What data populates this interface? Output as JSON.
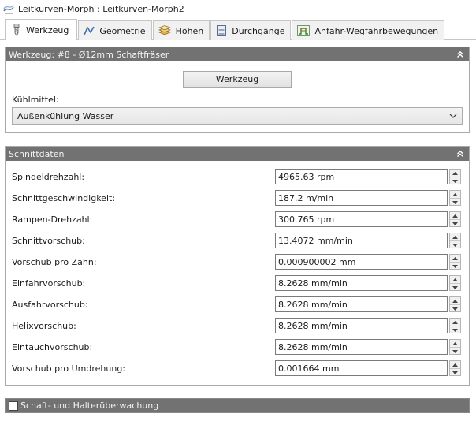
{
  "window": {
    "title": "Leitkurven-Morph : Leitkurven-Morph2"
  },
  "tabs": [
    {
      "label": "Werkzeug",
      "icon": "tool-icon",
      "active": true
    },
    {
      "label": "Geometrie",
      "icon": "geometry-icon",
      "active": false
    },
    {
      "label": "Höhen",
      "icon": "heights-icon",
      "active": false
    },
    {
      "label": "Durchgänge",
      "icon": "passes-icon",
      "active": false
    },
    {
      "label": "Anfahr-Wegfahrbewegungen",
      "icon": "linking-icon",
      "active": false
    }
  ],
  "tool_panel": {
    "header": "Werkzeug: #8 - Ø12mm Schaftfräser",
    "tool_button": "Werkzeug",
    "coolant_label": "Kühlmittel:",
    "coolant_value": "Außenkühlung Wasser"
  },
  "cut_panel": {
    "header": "Schnittdaten",
    "rows": [
      {
        "label": "Spindeldrehzahl:",
        "value": "4965.63 rpm"
      },
      {
        "label": "Schnittgeschwindigkeit:",
        "value": "187.2 m/min"
      },
      {
        "label": "Rampen-Drehzahl:",
        "value": "300.765 rpm"
      },
      {
        "label": "Schnittvorschub:",
        "value": "13.4072 mm/min"
      },
      {
        "label": "Vorschub pro Zahn:",
        "value": "0.000900002 mm"
      },
      {
        "label": "Einfahrvorschub:",
        "value": "8.2628 mm/min"
      },
      {
        "label": "Ausfahrvorschub:",
        "value": "8.2628 mm/min"
      },
      {
        "label": "Helixvorschub:",
        "value": "8.2628 mm/min"
      },
      {
        "label": "Eintauchvorschub:",
        "value": "8.2628 mm/min"
      },
      {
        "label": "Vorschub pro Umdrehung:",
        "value": "0.001664 mm"
      }
    ]
  },
  "holder_panel": {
    "header": "Schaft- und Halterüberwachung",
    "checked": false
  }
}
